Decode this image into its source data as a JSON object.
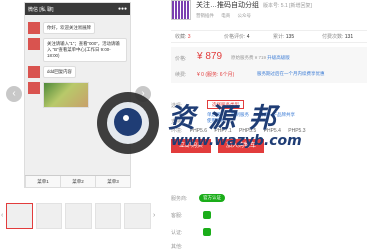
{
  "phone": {
    "status_left": "微信 [私 聊]",
    "status_right": "●●●",
    "messages": [
      "你好，欢迎关注易展牌",
      "关注请输入“1”；查看“000”，活动请输入 “B”查看菜单中心(工作日 9:00-18:00)",
      "ddd回复内容"
    ],
    "menu": [
      "菜单1",
      "菜单2",
      "菜单3"
    ]
  },
  "gallery": {
    "prev": "‹",
    "next": "›",
    "thumb_prev": "‹",
    "thumb_next": "›"
  },
  "product": {
    "title": "关注…推码自动分组",
    "version": "版本号: 5.1 [新增回复]",
    "tags": [
      "营销插件",
      "电商",
      "公众号"
    ],
    "stats": [
      {
        "label": "收藏:",
        "value": "3"
      },
      {
        "label": "价格评价:",
        "value": "4"
      },
      {
        "label": "累计:",
        "value": "135"
      },
      {
        "label": "付费次数:",
        "value": "131"
      }
    ],
    "price_label": "价格:",
    "price": "¥ 879",
    "price_note": "原始服务费 ¥ 719",
    "price_note_link": "升级高级版",
    "renew_label": "续费:",
    "renew": "¥ 0 (服务: 6个月)",
    "renew_note": "服务期过后在一个月内续费享优惠",
    "option_label": "选择:",
    "option_button": "选择服务类型",
    "option_links": [
      "单店版",
      "定制服务",
      "需要一下品牌共享"
    ],
    "support_label": "支持:",
    "support_link": "使用教程",
    "env_label": "环境:",
    "env_values": [
      "PHP5.6",
      "PHP7.1",
      "PHP5.5",
      "PHP5.4",
      "PHP5.3"
    ],
    "buy_button": "立即购买",
    "cart_button": "加入购物车",
    "service_label": "服务商:",
    "service_badge": "官方认证",
    "contact_label": "客服:",
    "cert_label": "认证:",
    "extra_label": "其他:"
  },
  "watermark": {
    "text": "资 源 邦",
    "url": "www.wazyb.com"
  }
}
